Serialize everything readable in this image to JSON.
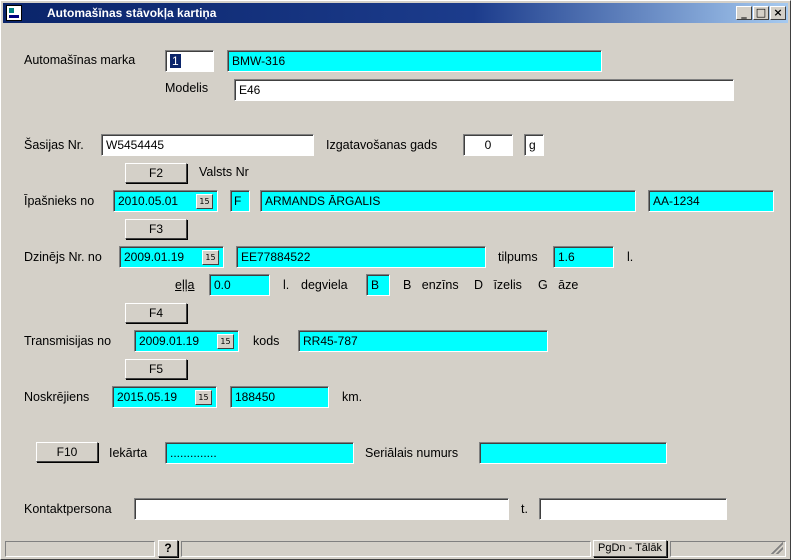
{
  "window": {
    "title": "Automašīnas stāvokļa kartiņa"
  },
  "car": {
    "make_label": "Automašīnas marka",
    "make_code": "1",
    "make_name": "BMW-316",
    "model_label": "Modelis",
    "model_value": "E46"
  },
  "chassis": {
    "label": "Šasijas Nr.",
    "value": "W5454445",
    "year_label": "Izgatavošanas gads",
    "year_value": "0",
    "year_unit": "g"
  },
  "owner": {
    "f2_label": "F2",
    "country_label": "Valsts Nr",
    "label": "Īpašnieks no",
    "date": "2010.05.01",
    "type": "F",
    "name": "ARMANDS ĀRGALIS",
    "plate": "AA-1234"
  },
  "engine": {
    "f3_label": "F3",
    "label": "Dzinējs Nr. no",
    "date": "2009.01.19",
    "number": "EE77884522",
    "volume_label": "tilpums",
    "volume_value": "1.6",
    "volume_unit": "l.",
    "oil_label": "eļļa",
    "oil_value": "0.0",
    "oil_unit": "l.",
    "fuel_label": "degviela",
    "fuel_value": "B",
    "fuel_b": "B",
    "fuel_b_rest": "enzīns",
    "fuel_d": "D",
    "fuel_d_rest": "īzelis",
    "fuel_g": "G",
    "fuel_g_rest": "āze"
  },
  "transmission": {
    "f4_label": "F4",
    "label": "Transmisijas no",
    "date": "2009.01.19",
    "code_label": "kods",
    "code_value": "RR45-787"
  },
  "mileage": {
    "f5_label": "F5",
    "label": "Noskrējiens",
    "date": "2015.05.19",
    "value": "188450",
    "unit": "km."
  },
  "device": {
    "f10_label": "F10",
    "label": "Iekārta",
    "value": "..............",
    "serial_label": "Seriālais numurs",
    "serial_value": ""
  },
  "contact": {
    "label": "Kontaktpersona",
    "value": "",
    "phone_label": "t.",
    "phone_value": ""
  },
  "statusbar": {
    "help": "?",
    "next": "PgDn - Tālāk"
  },
  "icons": {
    "calendar": "15",
    "minimize": "_",
    "maximize": "□",
    "close": "×"
  }
}
